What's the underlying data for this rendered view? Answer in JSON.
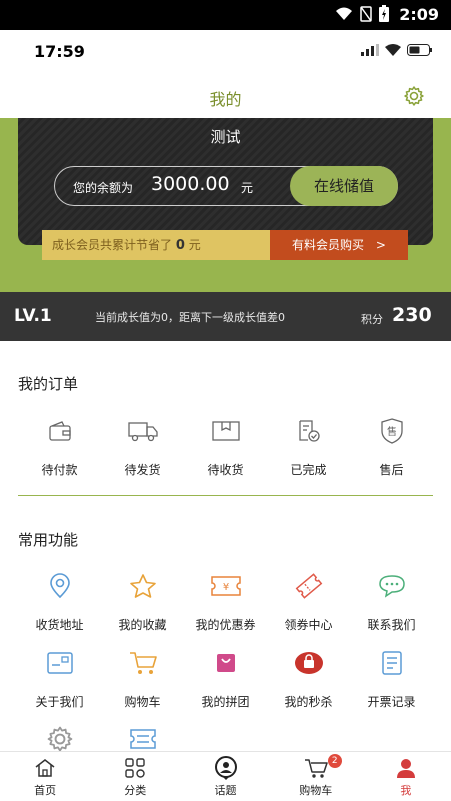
{
  "system_bar": {
    "time": "2:09"
  },
  "app_status": {
    "time": "17:59"
  },
  "nav": {
    "title": "我的"
  },
  "card": {
    "user_name": "测试",
    "balance_label": "您的余额为",
    "balance_amount": "3000.00",
    "balance_unit": "元",
    "recharge_label": "在线储值",
    "savings_prefix": "成长会员共累计节省了",
    "savings_amount": "0",
    "savings_unit": "元",
    "member_buy_label": "有料会员购买",
    "member_buy_arrow": ">"
  },
  "level": {
    "level_label": "LV.1",
    "growth_text": "当前成长值为0，距离下一级成长值差0",
    "points_label": "积分",
    "points_value": "230"
  },
  "orders": {
    "title": "我的订单",
    "items": [
      {
        "label": "待付款",
        "icon": "wallet-icon"
      },
      {
        "label": "待发货",
        "icon": "truck-icon"
      },
      {
        "label": "待收货",
        "icon": "package-icon"
      },
      {
        "label": "已完成",
        "icon": "completed-doc-icon"
      },
      {
        "label": "售后",
        "icon": "after-sales-shield-icon"
      }
    ]
  },
  "functions": {
    "title": "常用功能",
    "row1": [
      {
        "label": "收货地址",
        "icon": "location-pin-icon",
        "color": "#5b9bd5"
      },
      {
        "label": "我的收藏",
        "icon": "star-icon",
        "color": "#e8a33a"
      },
      {
        "label": "我的优惠券",
        "icon": "coupon-icon",
        "color": "#e8833a"
      },
      {
        "label": "领券中心",
        "icon": "ticket-icon",
        "color": "#e05a4a"
      },
      {
        "label": "联系我们",
        "icon": "chat-icon",
        "color": "#4caf7a"
      }
    ],
    "row2": [
      {
        "label": "关于我们",
        "icon": "info-card-icon",
        "color": "#5b9bd5"
      },
      {
        "label": "购物车",
        "icon": "cart-icon",
        "color": "#e8a33a"
      },
      {
        "label": "我的拼团",
        "icon": "group-bag-icon",
        "color": "#d04a8a"
      },
      {
        "label": "我的秒杀",
        "icon": "flash-sale-icon",
        "color": "#d43c3c"
      },
      {
        "label": "开票记录",
        "icon": "invoice-icon",
        "color": "#5b9bd5"
      }
    ],
    "row3": [
      {
        "label": "",
        "icon": "settings-icon",
        "color": "#999999"
      },
      {
        "label": "",
        "icon": "scan-ticket-icon",
        "color": "#5b9bd5"
      }
    ]
  },
  "tabbar": {
    "items": [
      {
        "label": "首页",
        "icon": "home-icon"
      },
      {
        "label": "分类",
        "icon": "category-icon"
      },
      {
        "label": "话题",
        "icon": "topic-icon"
      },
      {
        "label": "购物车",
        "icon": "cart-icon",
        "badge": "2"
      },
      {
        "label": "我",
        "icon": "profile-icon",
        "active": true
      }
    ]
  },
  "colors": {
    "brand_green": "#98b54e",
    "title_green": "#7a8f2c",
    "accent_red": "#c24c1e",
    "active_tab": "#d43c3c"
  }
}
